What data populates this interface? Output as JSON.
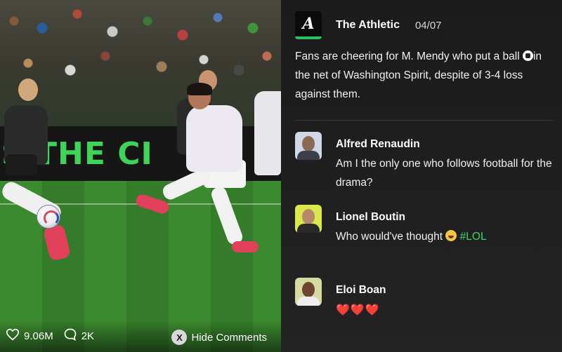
{
  "media": {
    "board_text": "S THE CI",
    "likes": "9.06M",
    "comments": "2K",
    "hide_comments_key": "X",
    "hide_comments_label": "Hide Comments"
  },
  "post": {
    "logo_letter": "A",
    "author": "The Athletic",
    "date": "04/07",
    "text_before_emoji": "Fans are cheering for M. Mendy who put a ball ",
    "emoji": "soccer-ball",
    "text_after_emoji": "in the net of Washington Spirit, despite of 3-4 loss against them."
  },
  "comments": [
    {
      "name": "Alfred Renaudin",
      "text": "Am I the only one who follows football for the drama?",
      "avatar_bg": "#cfd8e4"
    },
    {
      "name": "Lionel Boutin",
      "text": "Who would've thought ",
      "emoji": "laughing-face",
      "hashtag": "#LOL",
      "avatar_bg": "#d9e84a"
    },
    {
      "name": "Eloi Boan",
      "text": "❤️❤️❤️",
      "avatar_bg": "#d6d9a0"
    }
  ],
  "colors": {
    "accent_green": "#39d36e",
    "heart_red": "#e43a4a",
    "panel_bg": "#1b1b1b"
  },
  "icons": [
    "heart-outline-icon",
    "comment-bubble-icon",
    "x-button-icon"
  ]
}
